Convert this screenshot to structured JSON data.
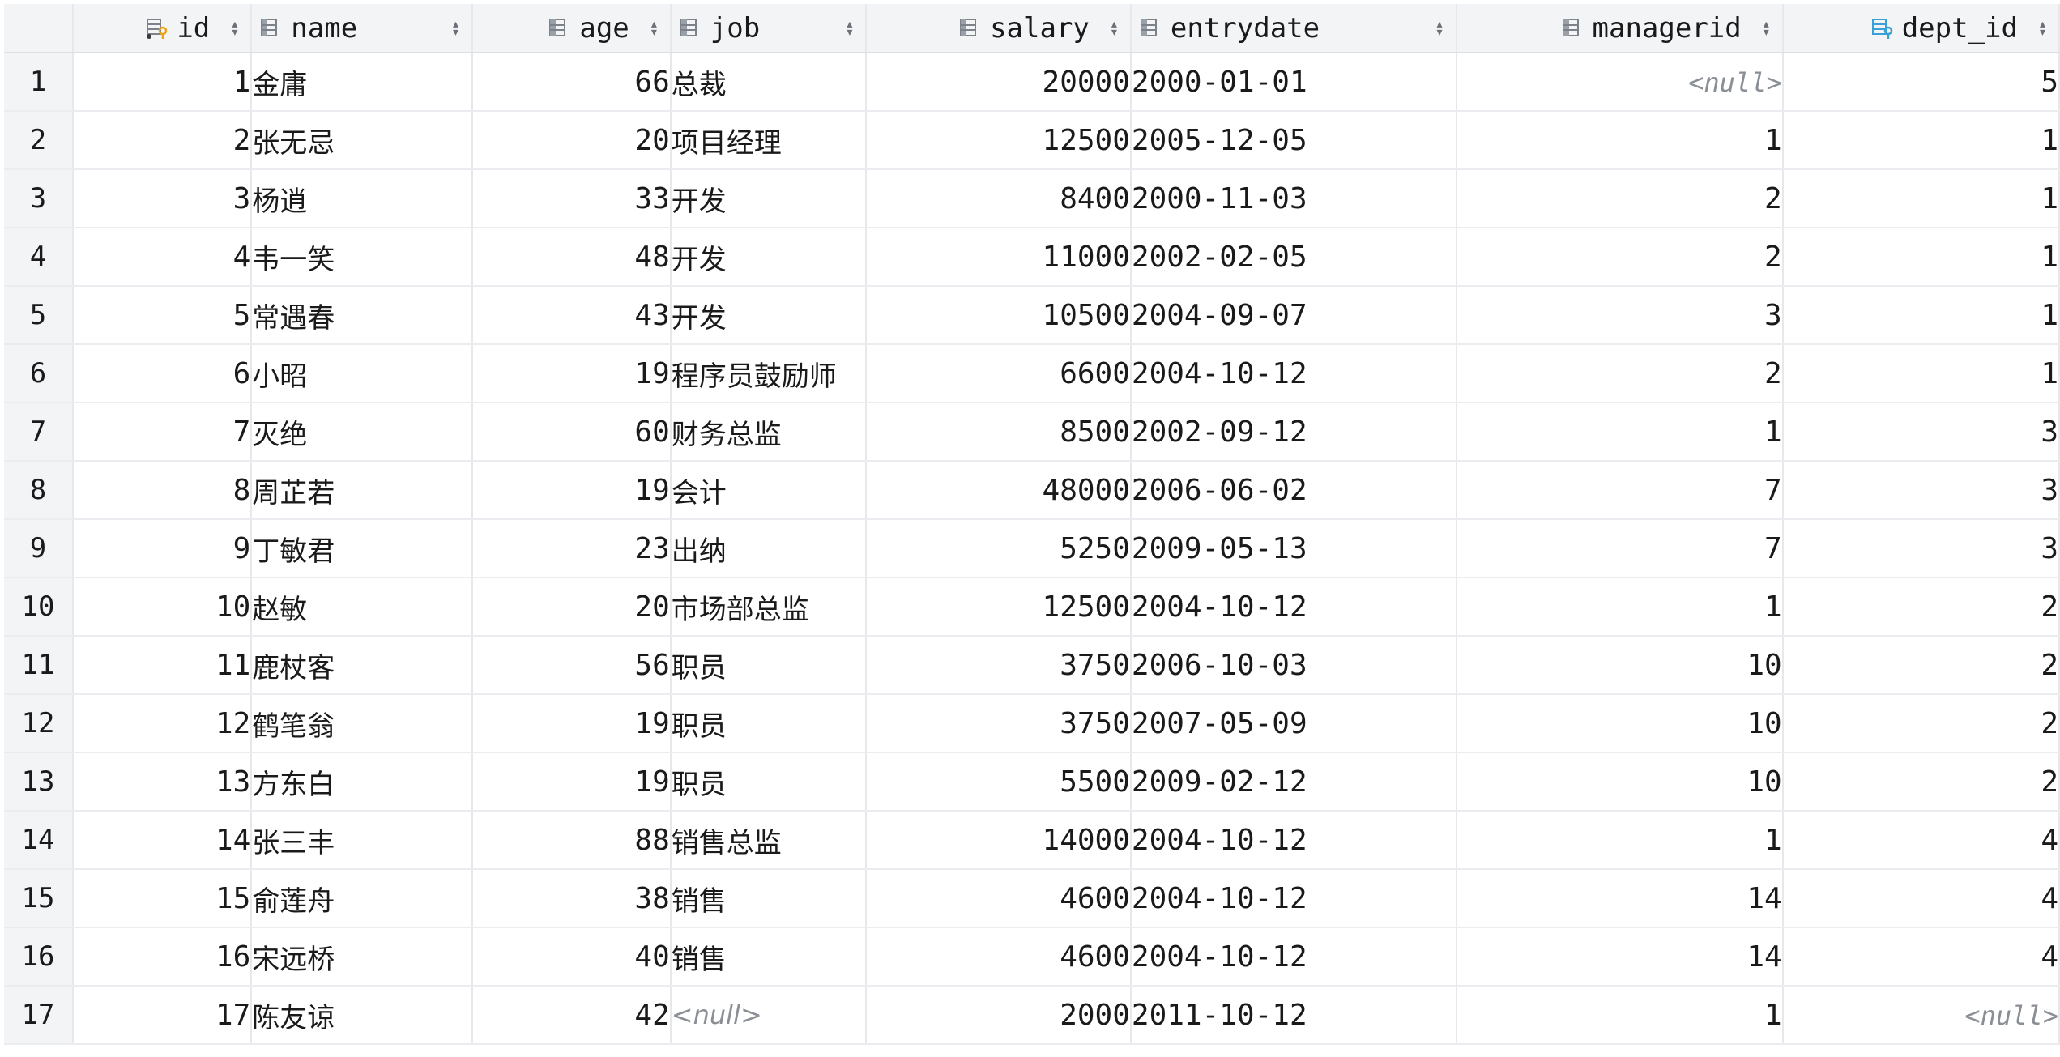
{
  "table": {
    "columns": [
      {
        "label": "id",
        "icon": "primary-key-column-icon",
        "align": "right"
      },
      {
        "label": "name",
        "icon": "column-icon",
        "align": "left"
      },
      {
        "label": "age",
        "icon": "column-icon",
        "align": "right"
      },
      {
        "label": "job",
        "icon": "column-icon",
        "align": "left"
      },
      {
        "label": "salary",
        "icon": "column-icon",
        "align": "right"
      },
      {
        "label": "entrydate",
        "icon": "column-icon",
        "align": "left"
      },
      {
        "label": "managerid",
        "icon": "column-icon",
        "align": "right"
      },
      {
        "label": "dept_id",
        "icon": "foreign-key-column-icon",
        "align": "right"
      }
    ],
    "null_text": "<null>",
    "rows": [
      {
        "n": "1",
        "id": "1",
        "name": "金庸",
        "age": "66",
        "job": "总裁",
        "salary": "20000",
        "entrydate": "2000-01-01",
        "managerid": null,
        "dept_id": "5"
      },
      {
        "n": "2",
        "id": "2",
        "name": "张无忌",
        "age": "20",
        "job": "项目经理",
        "salary": "12500",
        "entrydate": "2005-12-05",
        "managerid": "1",
        "dept_id": "1"
      },
      {
        "n": "3",
        "id": "3",
        "name": "杨逍",
        "age": "33",
        "job": "开发",
        "salary": "8400",
        "entrydate": "2000-11-03",
        "managerid": "2",
        "dept_id": "1"
      },
      {
        "n": "4",
        "id": "4",
        "name": "韦一笑",
        "age": "48",
        "job": "开发",
        "salary": "11000",
        "entrydate": "2002-02-05",
        "managerid": "2",
        "dept_id": "1"
      },
      {
        "n": "5",
        "id": "5",
        "name": "常遇春",
        "age": "43",
        "job": "开发",
        "salary": "10500",
        "entrydate": "2004-09-07",
        "managerid": "3",
        "dept_id": "1"
      },
      {
        "n": "6",
        "id": "6",
        "name": "小昭",
        "age": "19",
        "job": "程序员鼓励师",
        "salary": "6600",
        "entrydate": "2004-10-12",
        "managerid": "2",
        "dept_id": "1"
      },
      {
        "n": "7",
        "id": "7",
        "name": "灭绝",
        "age": "60",
        "job": "财务总监",
        "salary": "8500",
        "entrydate": "2002-09-12",
        "managerid": "1",
        "dept_id": "3"
      },
      {
        "n": "8",
        "id": "8",
        "name": "周芷若",
        "age": "19",
        "job": "会计",
        "salary": "48000",
        "entrydate": "2006-06-02",
        "managerid": "7",
        "dept_id": "3"
      },
      {
        "n": "9",
        "id": "9",
        "name": "丁敏君",
        "age": "23",
        "job": "出纳",
        "salary": "5250",
        "entrydate": "2009-05-13",
        "managerid": "7",
        "dept_id": "3"
      },
      {
        "n": "10",
        "id": "10",
        "name": "赵敏",
        "age": "20",
        "job": "市场部总监",
        "salary": "12500",
        "entrydate": "2004-10-12",
        "managerid": "1",
        "dept_id": "2"
      },
      {
        "n": "11",
        "id": "11",
        "name": "鹿杖客",
        "age": "56",
        "job": "职员",
        "salary": "3750",
        "entrydate": "2006-10-03",
        "managerid": "10",
        "dept_id": "2"
      },
      {
        "n": "12",
        "id": "12",
        "name": "鹤笔翁",
        "age": "19",
        "job": "职员",
        "salary": "3750",
        "entrydate": "2007-05-09",
        "managerid": "10",
        "dept_id": "2"
      },
      {
        "n": "13",
        "id": "13",
        "name": "方东白",
        "age": "19",
        "job": "职员",
        "salary": "5500",
        "entrydate": "2009-02-12",
        "managerid": "10",
        "dept_id": "2"
      },
      {
        "n": "14",
        "id": "14",
        "name": "张三丰",
        "age": "88",
        "job": "销售总监",
        "salary": "14000",
        "entrydate": "2004-10-12",
        "managerid": "1",
        "dept_id": "4"
      },
      {
        "n": "15",
        "id": "15",
        "name": "俞莲舟",
        "age": "38",
        "job": "销售",
        "salary": "4600",
        "entrydate": "2004-10-12",
        "managerid": "14",
        "dept_id": "4"
      },
      {
        "n": "16",
        "id": "16",
        "name": "宋远桥",
        "age": "40",
        "job": "销售",
        "salary": "4600",
        "entrydate": "2004-10-12",
        "managerid": "14",
        "dept_id": "4"
      },
      {
        "n": "17",
        "id": "17",
        "name": "陈友谅",
        "age": "42",
        "job": null,
        "salary": "2000",
        "entrydate": "2011-10-12",
        "managerid": "1",
        "dept_id": null
      }
    ]
  },
  "colors": {
    "header_bg": "#f3f4f6",
    "grid_line": "#e6e8ec",
    "null_text": "#8a8e95",
    "key_icon": "#e8a317",
    "fk_icon": "#3aa0d8"
  }
}
